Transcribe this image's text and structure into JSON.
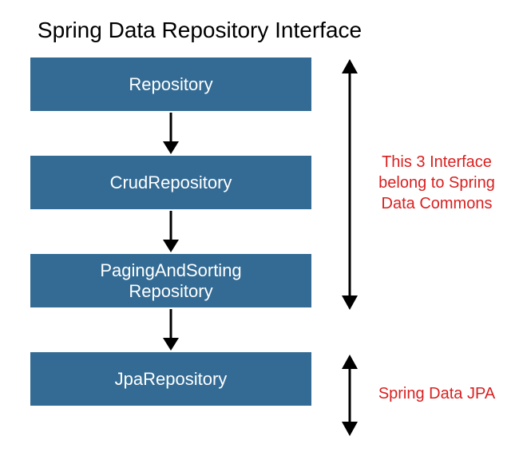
{
  "title": "Spring Data Repository Interface",
  "boxes": {
    "b1": "Repository",
    "b2": "CrudRepository",
    "b3_line1": "PagingAndSorting",
    "b3_line2": "Repository",
    "b4": "JpaRepository"
  },
  "annotations": {
    "a1_line1": "This 3 Interface",
    "a1_line2": "belong to Spring",
    "a1_line3": "Data Commons",
    "a2": "Spring Data JPA"
  },
  "colors": {
    "box_bg": "#336b94",
    "box_text": "#ffffff",
    "annotation_text": "#d92020"
  }
}
